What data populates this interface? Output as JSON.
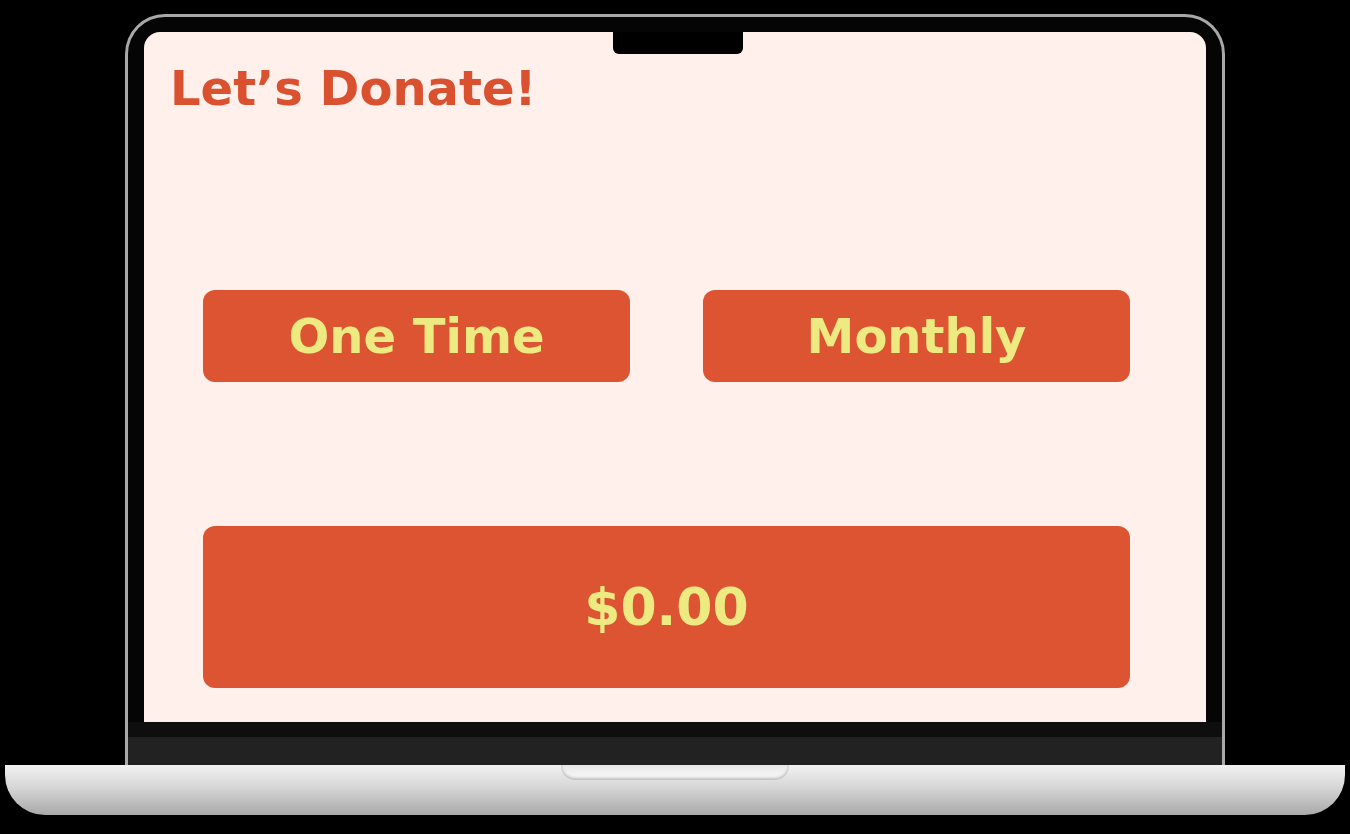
{
  "title": "Let’s Donate!",
  "frequency_options": [
    {
      "label": "One Time",
      "selected": false
    },
    {
      "label": "Monthly",
      "selected": false
    }
  ],
  "amount": "$0.00"
}
